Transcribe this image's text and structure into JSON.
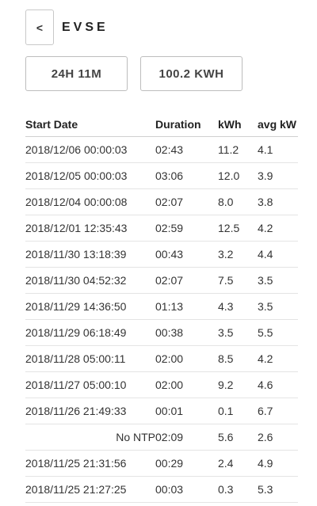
{
  "header": {
    "back_label": "<",
    "title": "EVSE"
  },
  "stats": {
    "duration": "24H 11M",
    "energy": "100.2 KWH"
  },
  "table": {
    "columns": [
      "Start Date",
      "Duration",
      "kWh",
      "avg kW"
    ],
    "rows": [
      [
        "2018/12/06 00:00:03",
        "02:43",
        "11.2",
        "4.1"
      ],
      [
        "2018/12/05 00:00:03",
        "03:06",
        "12.0",
        "3.9"
      ],
      [
        "2018/12/04 00:00:08",
        "02:07",
        "8.0",
        "3.8"
      ],
      [
        "2018/12/01 12:35:43",
        "02:59",
        "12.5",
        "4.2"
      ],
      [
        "2018/11/30 13:18:39",
        "00:43",
        "3.2",
        "4.4"
      ],
      [
        "2018/11/30 04:52:32",
        "02:07",
        "7.5",
        "3.5"
      ],
      [
        "2018/11/29 14:36:50",
        "01:13",
        "4.3",
        "3.5"
      ],
      [
        "2018/11/29 06:18:49",
        "00:38",
        "3.5",
        "5.5"
      ],
      [
        "2018/11/28 05:00:11",
        "02:00",
        "8.5",
        "4.2"
      ],
      [
        "2018/11/27 05:00:10",
        "02:00",
        "9.2",
        "4.6"
      ],
      [
        "2018/11/26 21:49:33",
        "00:01",
        "0.1",
        "6.7"
      ],
      [
        "No NTP",
        "02:09",
        "5.6",
        "2.6"
      ],
      [
        "2018/11/25 21:31:56",
        "00:29",
        "2.4",
        "4.9"
      ],
      [
        "2018/11/25 21:27:25",
        "00:03",
        "0.3",
        "5.3"
      ]
    ]
  }
}
